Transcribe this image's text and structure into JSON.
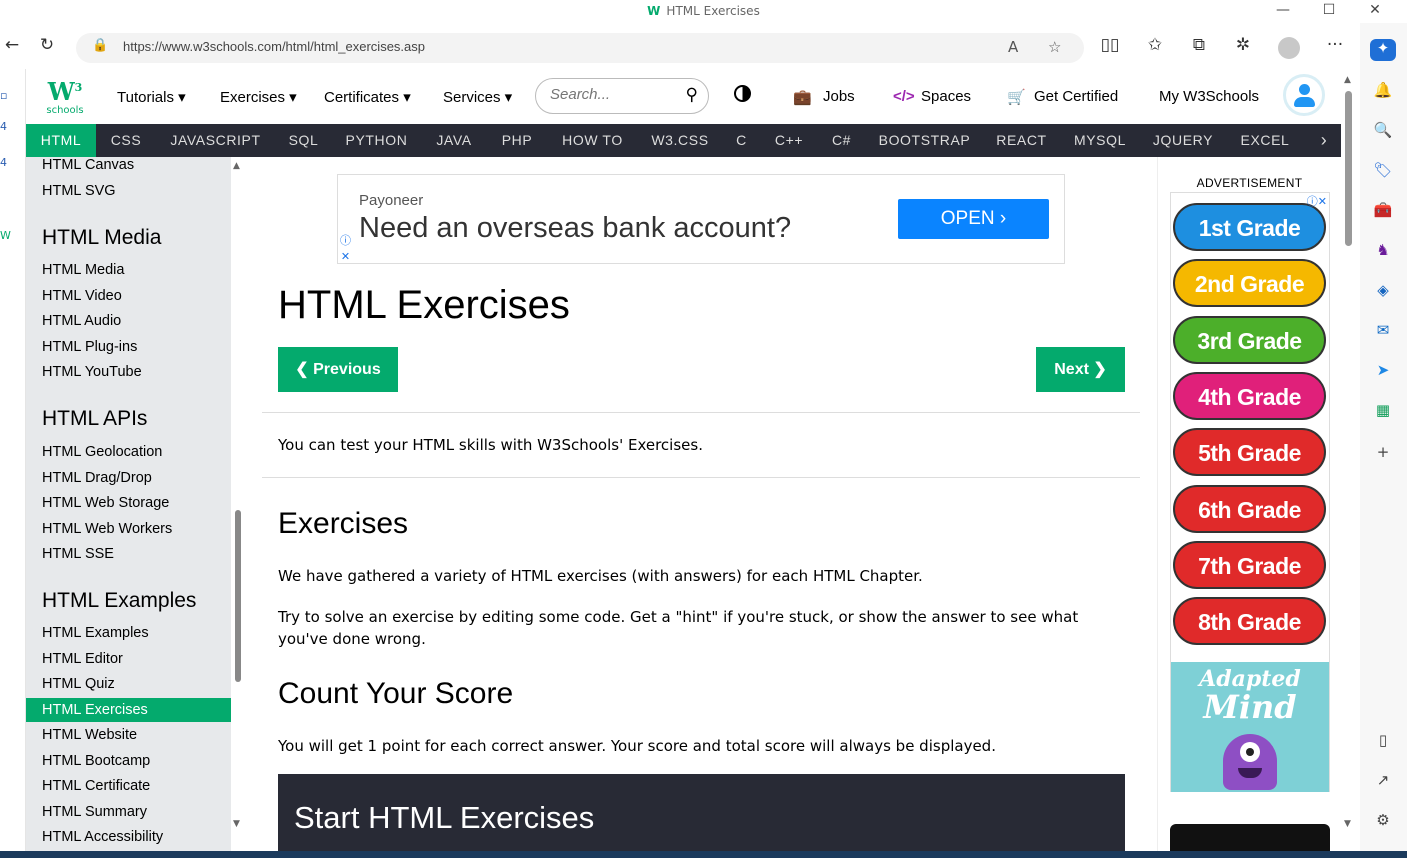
{
  "window": {
    "title": "HTML Exercises",
    "controls": {
      "minimize": "—",
      "maximize": "☐",
      "close": "✕"
    }
  },
  "browser": {
    "url": "https://www.w3schools.com/html/html_exercises.asp",
    "back_icon": "←",
    "reload_icon": "↻",
    "lock_icon": "🔒",
    "read_aloud_icon": "A",
    "favorite_icon": "☆",
    "split_icon": "▯▯",
    "favorites_icon": "✩",
    "collections_icon": "⧉",
    "extensions_icon": "✲",
    "more_icon": "···"
  },
  "w3": {
    "logo_text": "W",
    "logo_sup": "3",
    "logo_sub": "schools",
    "nav": {
      "tutorials": "Tutorials ▾",
      "exercises": "Exercises ▾",
      "certificates": "Certificates ▾",
      "services": "Services ▾",
      "jobs": "Jobs",
      "spaces": "Spaces",
      "get_certified": "Get Certified",
      "my_w3schools": "My W3Schools"
    },
    "search_placeholder": "Search...",
    "search_icon": "⚲",
    "jobs_icon": "💼",
    "spaces_icon": "</>",
    "cart_icon": "🛒"
  },
  "topics": [
    "HTML",
    "CSS",
    "JAVASCRIPT",
    "SQL",
    "PYTHON",
    "JAVA",
    "PHP",
    "HOW TO",
    "W3.CSS",
    "C",
    "C++",
    "C#",
    "BOOTSTRAP",
    "REACT",
    "MYSQL",
    "JQUERY",
    "EXCEL"
  ],
  "topics_next": "›",
  "sidebar": {
    "items_top": [
      "HTML Canvas",
      "HTML SVG"
    ],
    "media_head": "HTML Media",
    "media_items": [
      "HTML Media",
      "HTML Video",
      "HTML Audio",
      "HTML Plug-ins",
      "HTML YouTube"
    ],
    "apis_head": "HTML APIs",
    "apis_items": [
      "HTML Geolocation",
      "HTML Drag/Drop",
      "HTML Web Storage",
      "HTML Web Workers",
      "HTML SSE"
    ],
    "examples_head": "HTML Examples",
    "examples_items": [
      "HTML Examples",
      "HTML Editor",
      "HTML Quiz",
      "HTML Exercises",
      "HTML Website",
      "HTML Bootcamp",
      "HTML Certificate",
      "HTML Summary",
      "HTML Accessibility"
    ],
    "active": "HTML Exercises"
  },
  "ad_top": {
    "brand": "Payoneer",
    "headline": "Need an overseas bank account?",
    "button": "OPEN ›"
  },
  "main": {
    "title": "HTML Exercises",
    "prev_button": "❮ Previous",
    "next_button": "Next ❯",
    "intro": "You can test your HTML skills with W3Schools' Exercises.",
    "h_exercises": "Exercises",
    "p1": "We have gathered a variety of HTML exercises (with answers) for each HTML Chapter.",
    "p2": "Try to solve an exercise by editing some code. Get a \"hint\" if you're stuck, or show the answer to see what you've done wrong.",
    "h_score": "Count Your Score",
    "p3": "You will get 1 point for each correct answer. Your score and total score will always be displayed.",
    "start_box": "Start HTML Exercises"
  },
  "right_ad": {
    "label": "ADVERTISEMENT",
    "grades": [
      {
        "label": "1st Grade",
        "color": "#1e8fe0"
      },
      {
        "label": "2nd Grade",
        "color": "#f5b800"
      },
      {
        "label": "3rd Grade",
        "color": "#4caf2a"
      },
      {
        "label": "4th Grade",
        "color": "#e0207a"
      },
      {
        "label": "5th Grade",
        "color": "#e02a2a"
      },
      {
        "label": "6th Grade",
        "color": "#e02a2a"
      },
      {
        "label": "7th Grade",
        "color": "#e02a2a"
      },
      {
        "label": "8th Grade",
        "color": "#e02a2a"
      }
    ],
    "adapted_line1": "Adapted",
    "adapted_line2": "Mind"
  }
}
